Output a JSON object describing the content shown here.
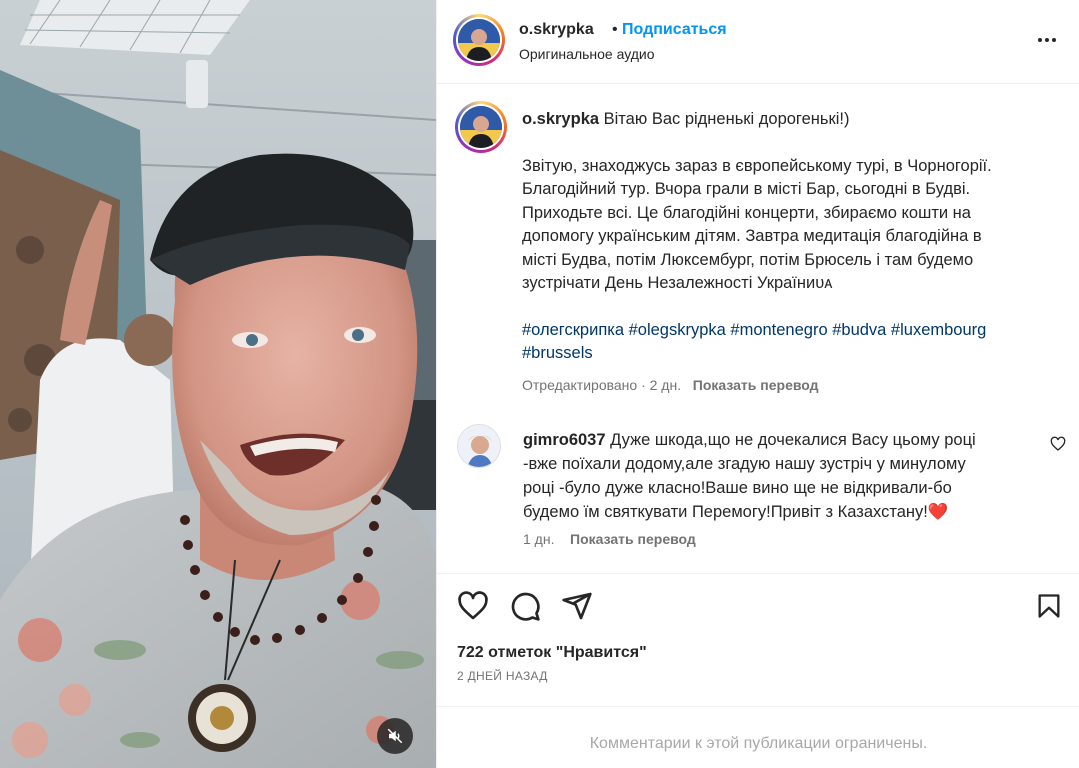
{
  "post": {
    "username": "o.skrypka",
    "follow_label": "Подписаться",
    "separator": "•",
    "audio_label": "Оригинальное аудио",
    "caption_greeting": "Вітаю Вас рідненькі дорогенькі!)",
    "caption_body": "Звітую, знаходжусь зараз в європейському турі, в Чорногорії.\nБлагодійний тур. Вчора грали в місті Бар, сьогодні в Будві.\nПриходьте всі. Це благодійні концерти, збираємо кошти на\nдопомогу українським дітям. Завтра медитація благодійна в\nмісті Будва, потім Люксембург, потім Брюсель і там будемо\nзустрічати День Незалежності Україниᴜᴀ",
    "hashtags": "#олегскрипка #olegskrypka #montenegro #budva #luxembourg\n#brussels",
    "caption_meta": "Отредактировано · 2 дн.",
    "translate_label": "Показать перевод",
    "likes": "722 отметок \"Нравится\"",
    "time_ago": "2 ДНЕЙ НАЗАД",
    "comments_limited": "Комментарии к этой публикации ограничены."
  },
  "comment": {
    "username": "gimro6037",
    "text": "Дуже шкода,що не дочекалися Васу цьому році\n-вже поїхали додому,але згадую нашу зустріч у минулому\nроці -було дуже класно!Ваше вино ще не відкривали-бо\nбудемо їм святкувати Перемогу!Привіт з Казахстану!❤️",
    "age": "1 дн.",
    "translate_label": "Показать перевод"
  },
  "icons": {
    "more": "more-options-icon",
    "like": "heart-icon",
    "comment": "comment-icon",
    "share": "send-icon",
    "save": "bookmark-icon",
    "mute": "muted-speaker-icon",
    "comment_like": "small-heart-icon"
  },
  "colors": {
    "accent": "#0095f6",
    "hashtag": "#00376b",
    "secondary_text": "#737373",
    "muted_text": "#a8a8a8"
  }
}
